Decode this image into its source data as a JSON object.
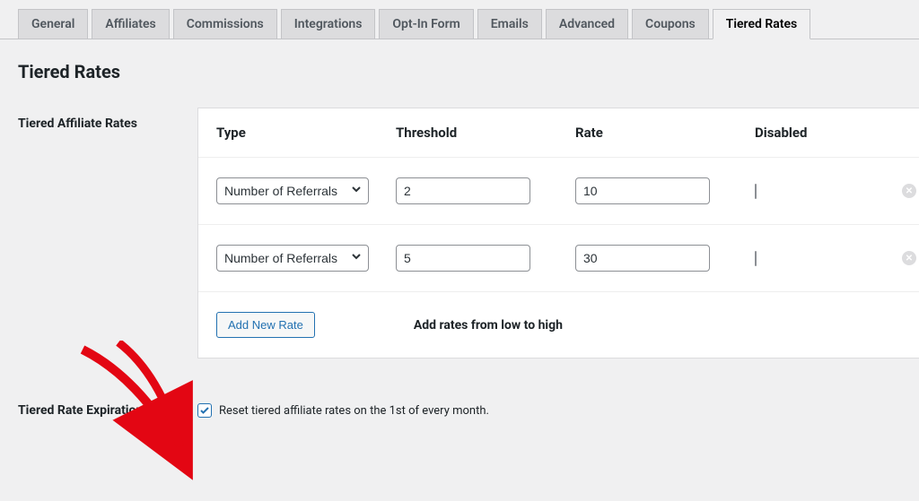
{
  "tabs": [
    {
      "label": "General"
    },
    {
      "label": "Affiliates"
    },
    {
      "label": "Commissions"
    },
    {
      "label": "Integrations"
    },
    {
      "label": "Opt-In Form"
    },
    {
      "label": "Emails"
    },
    {
      "label": "Advanced"
    },
    {
      "label": "Coupons"
    },
    {
      "label": "Tiered Rates",
      "active": true
    }
  ],
  "page_title": "Tiered Rates",
  "section_label": "Tiered Affiliate Rates",
  "headers": {
    "type": "Type",
    "threshold": "Threshold",
    "rate": "Rate",
    "disabled": "Disabled"
  },
  "type_option": "Number of Referrals",
  "rows": [
    {
      "threshold": "2",
      "rate": "10",
      "disabled": false
    },
    {
      "threshold": "5",
      "rate": "30",
      "disabled": false
    }
  ],
  "add_button": "Add New Rate",
  "footer_note": "Add rates from low to high",
  "expiration": {
    "label": "Tiered Rate Expiration",
    "checkbox_label": "Reset tiered affiliate rates on the 1st of every month.",
    "checked": true
  }
}
